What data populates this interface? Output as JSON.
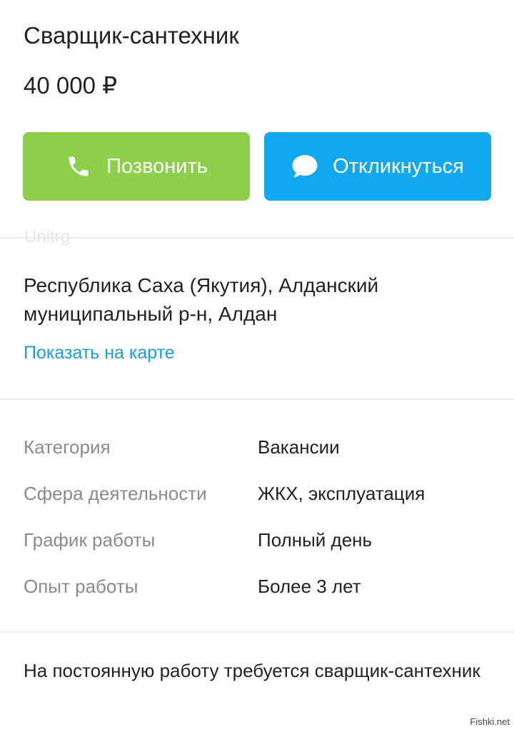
{
  "listing": {
    "title": "Сварщик-сантехник",
    "price": "40 000 ₽"
  },
  "actions": {
    "call_label": "Позвонить",
    "call_icon": "phone-icon",
    "reply_label": "Откликнуться",
    "reply_icon": "chat-bubble-icon",
    "call_color": "#8dcf4b",
    "reply_color": "#12a8f1"
  },
  "location": {
    "ghost_text": "Unitrg",
    "address": "Республика Саха (Якутия), Алданский муниципальный р-н, Алдан",
    "map_link": "Показать на карте",
    "link_color": "#1a9be0"
  },
  "params": [
    {
      "label": "Категория",
      "value": "Вакансии"
    },
    {
      "label": "Сфера деятельности",
      "value": "ЖКХ, эксплуатация"
    },
    {
      "label": "График работы",
      "value": "Полный день"
    },
    {
      "label": "Опыт работы",
      "value": "Более 3 лет"
    }
  ],
  "description": {
    "text": "На постоянную работу требуется сварщик-сантехник"
  },
  "watermark": {
    "text": "Fishki.net"
  }
}
